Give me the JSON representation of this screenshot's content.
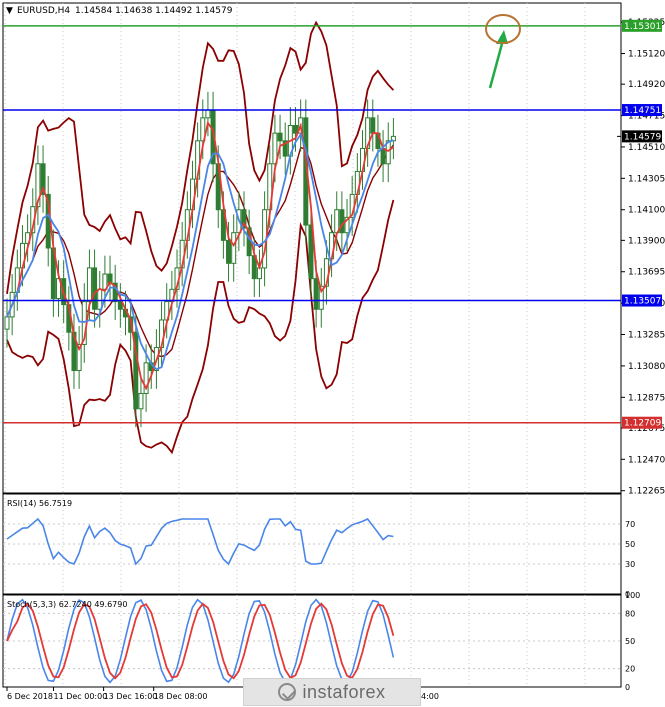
{
  "header": {
    "symbol_label": "EURUSD,H4",
    "ohlc": "1.14584 1.14638 1.14492 1.14579"
  },
  "colors": {
    "grid": "#c8c8c8",
    "candle": "#2e7d32",
    "upper_band": "#8b0000",
    "fast_ma": "#e53935",
    "slow_ma": "#4a86e8",
    "level_blue": "#0000ee",
    "level_green": "#2aa02a",
    "level_red": "#d32f2f",
    "arrow": "#22aa44",
    "circle": "#b87333"
  },
  "main_axis": {
    "ticks": [
      "1.15325",
      "1.15120",
      "1.14920",
      "1.14715",
      "1.14510",
      "1.14305",
      "1.14100",
      "1.13900",
      "1.13695",
      "1.13490",
      "1.13285",
      "1.13080",
      "1.12875",
      "1.12675",
      "1.12470",
      "1.12265"
    ],
    "y_min": 1.1225,
    "y_max": 1.1545
  },
  "levels": [
    {
      "id": "green",
      "value": 1.15301,
      "label": "1.15301"
    },
    {
      "id": "blue_top",
      "value": 1.14751,
      "label": "1.14751"
    },
    {
      "id": "current",
      "value": 1.14579,
      "label": "1.14579"
    },
    {
      "id": "blue_bottom",
      "value": 1.13507,
      "label": "1.13507"
    },
    {
      "id": "red",
      "value": 1.12709,
      "label": "1.12709"
    }
  ],
  "rsi": {
    "label": "RSI(14) 56.7519",
    "ticks": [
      "70",
      "50",
      "30",
      "0"
    ],
    "y_min": 0,
    "y_max": 100
  },
  "stoch": {
    "label": "Stoch(5,3,3) 62.7240 49.6790",
    "ticks": [
      "100",
      "80",
      "50",
      "20",
      "0"
    ],
    "y_min": 0,
    "y_max": 100
  },
  "x_axis": {
    "labels": [
      "6 Dec 2018",
      "11 Dec 00:00",
      "13 Dec 16:00",
      "18 Dec 08:00",
      "4 Jan 12:00",
      "9 Jan 04:00"
    ],
    "label_bars": [
      0,
      13,
      27,
      41,
      95,
      108
    ],
    "total_bars": 135
  },
  "watermark": {
    "text": "instaforex"
  },
  "chart_data": {
    "type": "line",
    "title": "EURUSD,H4",
    "series": [
      {
        "name": "Close",
        "values": [
          1.134,
          1.1356,
          1.1372,
          1.1388,
          1.1395,
          1.1412,
          1.144,
          1.142,
          1.1385,
          1.1352,
          1.1365,
          1.1348,
          1.133,
          1.1305,
          1.1322,
          1.135,
          1.1372,
          1.1345,
          1.1358,
          1.1368,
          1.1362,
          1.135,
          1.1345,
          1.134,
          1.133,
          1.128,
          1.129,
          1.131,
          1.1305,
          1.132,
          1.1338,
          1.135,
          1.1358,
          1.1372,
          1.139,
          1.141,
          1.143,
          1.1455,
          1.147,
          1.1475,
          1.144,
          1.141,
          1.139,
          1.1375,
          1.1395,
          1.141,
          1.1398,
          1.138,
          1.1365,
          1.1372,
          1.141,
          1.144,
          1.146,
          1.1455,
          1.1445,
          1.1465,
          1.146,
          1.147,
          1.14,
          1.1365,
          1.1345,
          1.136,
          1.1378,
          1.1395,
          1.141,
          1.1395,
          1.1405,
          1.142,
          1.1435,
          1.145,
          1.147,
          1.146,
          1.145,
          1.144,
          1.1455,
          1.14579
        ]
      }
    ],
    "xlabel": "",
    "ylabel": "",
    "ylim": [
      1.1225,
      1.1545
    ],
    "grid": true
  }
}
